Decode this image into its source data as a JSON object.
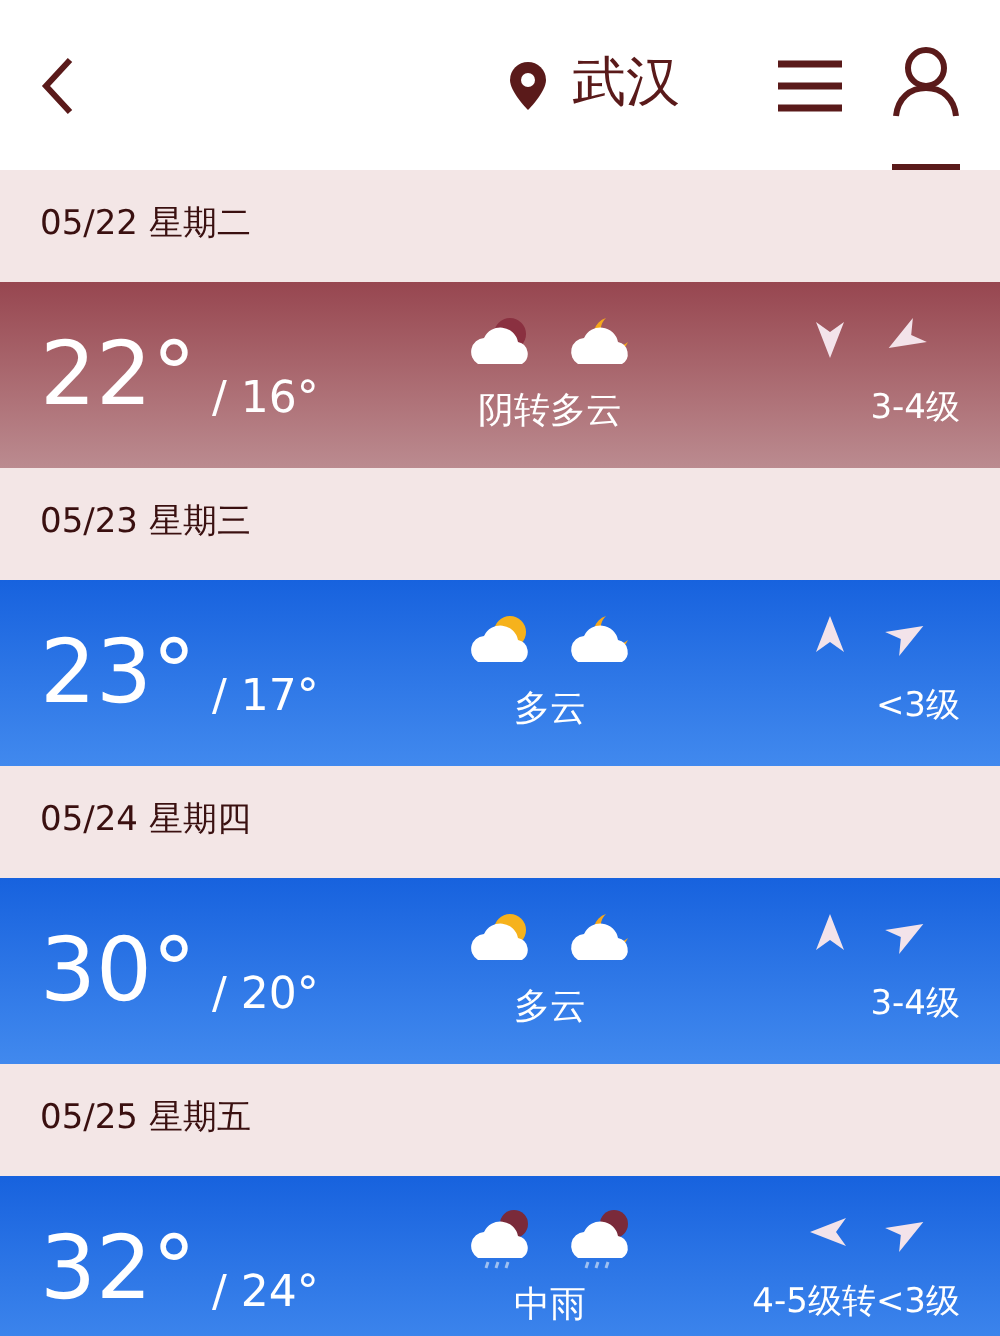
{
  "header": {
    "city": "武汉",
    "user_selected": true
  },
  "days": [
    {
      "date": "05/22 星期二",
      "high": "22°",
      "low": "/ 16°",
      "weather": "阴转多云",
      "wind": "3-4级",
      "icons": [
        {
          "kind": "overcast"
        },
        {
          "kind": "night"
        }
      ],
      "arrows": [
        {
          "kind": "south"
        },
        {
          "kind": "southwest"
        }
      ],
      "selected": true
    },
    {
      "date": "05/23 星期三",
      "high": "23°",
      "low": "/ 17°",
      "weather": "多云",
      "wind": "<3级",
      "icons": [
        {
          "kind": "day"
        },
        {
          "kind": "night"
        }
      ],
      "arrows": [
        {
          "kind": "north"
        },
        {
          "kind": "northeast"
        }
      ],
      "selected": false
    },
    {
      "date": "05/24 星期四",
      "high": "30°",
      "low": "/ 20°",
      "weather": "多云",
      "wind": "3-4级",
      "icons": [
        {
          "kind": "day"
        },
        {
          "kind": "night"
        }
      ],
      "arrows": [
        {
          "kind": "north"
        },
        {
          "kind": "northeast"
        }
      ],
      "selected": false
    },
    {
      "date": "05/25 星期五",
      "high": "32°",
      "low": "/ 24°",
      "weather": "中雨",
      "wind": "4-5级转<3级",
      "icons": [
        {
          "kind": "rain"
        },
        {
          "kind": "rain"
        }
      ],
      "arrows": [
        {
          "kind": "west"
        },
        {
          "kind": "northeast"
        }
      ],
      "selected": false
    }
  ]
}
